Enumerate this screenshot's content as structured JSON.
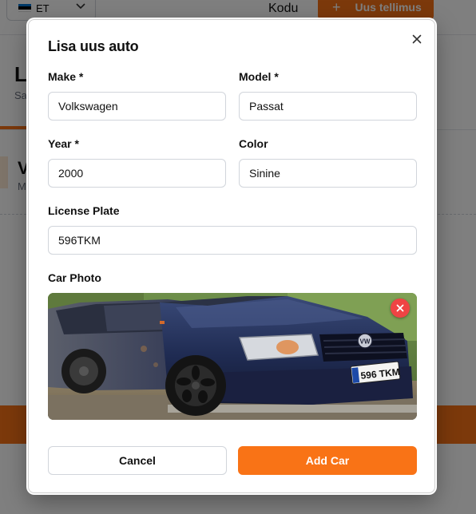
{
  "background": {
    "language": {
      "flag_colors": [
        "#0072CE",
        "#000000",
        "#FFFFFF"
      ],
      "code": "ET"
    },
    "nav": {
      "home_label": "Kodu",
      "new_order_label": "Uus tellimus"
    },
    "page": {
      "heading_initial": "L",
      "subheading_initial": "Sa"
    },
    "card": {
      "title_initial": "V",
      "subtitle_initial": "M"
    }
  },
  "modal": {
    "title": "Lisa uus auto",
    "close_icon": "close-icon",
    "fields": {
      "make": {
        "label": "Make *",
        "value": "Volkswagen"
      },
      "model": {
        "label": "Model *",
        "value": "Passat"
      },
      "year": {
        "label": "Year *",
        "value": "2000"
      },
      "color": {
        "label": "Color",
        "value": "Sinine"
      },
      "license_plate": {
        "label": "License Plate",
        "value": "596TKM"
      }
    },
    "photo": {
      "label": "Car Photo",
      "plate_text": "596 TKM",
      "badge_text": "VW",
      "remove_icon": "close-icon"
    },
    "buttons": {
      "cancel": "Cancel",
      "add": "Add Car"
    }
  },
  "colors": {
    "accent": "#F97316",
    "danger": "#EF4444",
    "overlay": "rgba(0,0,0,0.5)"
  }
}
